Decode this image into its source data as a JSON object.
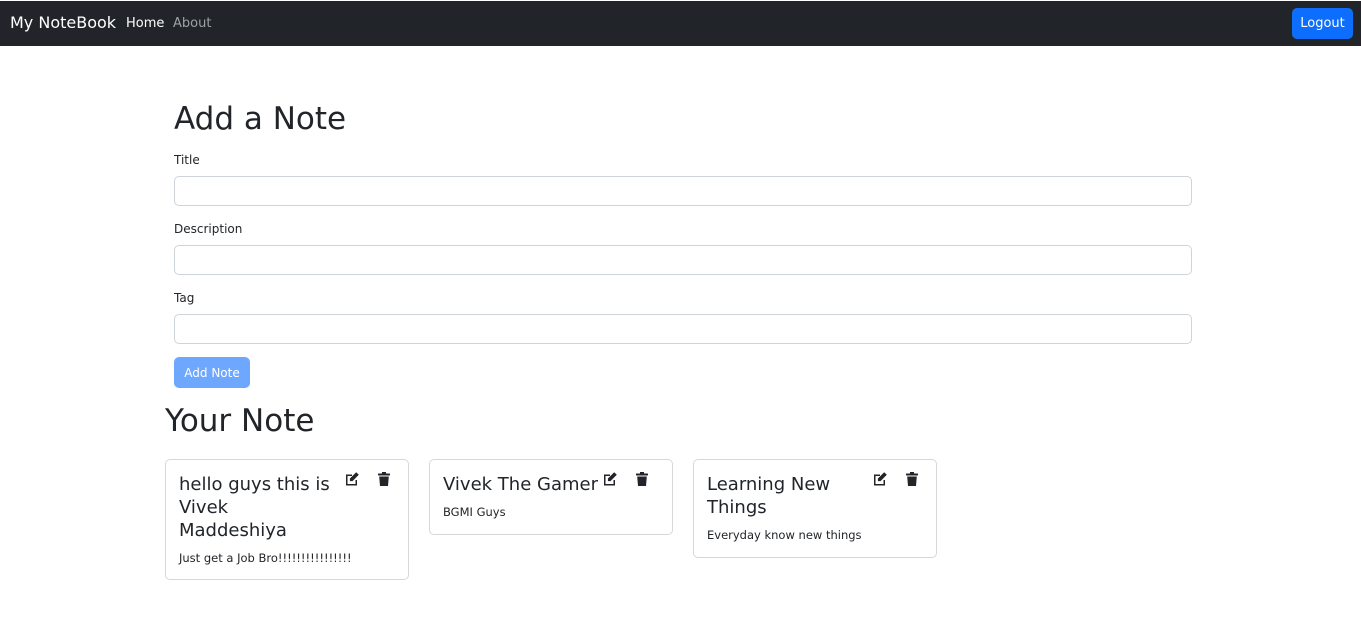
{
  "navbar": {
    "brand": "My NoteBook",
    "links": [
      "Home",
      "About"
    ],
    "logout_label": "Logout"
  },
  "add_form": {
    "heading": "Add a Note",
    "title_label": "Title",
    "description_label": "Description",
    "tag_label": "Tag",
    "title_value": "",
    "description_value": "",
    "tag_value": "",
    "submit_label": "Add Note"
  },
  "notes_section": {
    "heading": "Your Note",
    "notes": [
      {
        "title": "hello guys this is Vivek Maddeshiya",
        "description": "Just get a Job Bro!!!!!!!!!!!!!!!!"
      },
      {
        "title": "Vivek The Gamer",
        "description": "BGMI Guys"
      },
      {
        "title": "Learning New Things",
        "description": "Everyday know new things"
      }
    ]
  },
  "colors": {
    "navbar_bg": "#212529",
    "primary": "#0d6efd",
    "primary_disabled": "#6ea8fe"
  },
  "icons": [
    "edit-icon",
    "trash-icon"
  ]
}
